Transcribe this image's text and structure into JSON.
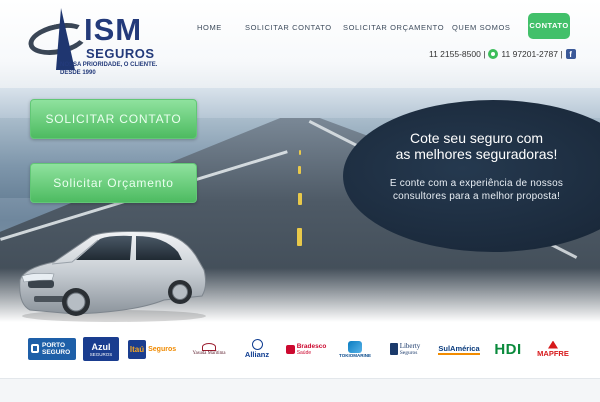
{
  "logo": {
    "name": "ISM",
    "sub": "SEGUROS",
    "tagline": "NOSSA PRIORIDADE, O CLIENTE.",
    "since": "DESDE 1990"
  },
  "nav": {
    "items": [
      "HOME",
      "SOLICITAR CONTATO",
      "SOLICITAR ORÇAMENTO",
      "QUEM SOMOS"
    ],
    "cta": "CONTATO"
  },
  "contact": {
    "phone1": "11 2155-8500 |",
    "phone2": "11 97201-2787 |",
    "facebook": "f"
  },
  "hero": {
    "btn_contato": "SOLICITAR CONTATO",
    "btn_orcamento": "Solicitar Orçamento",
    "promo_line1": "Cote seu seguro com",
    "promo_line2": "as melhores seguradoras!",
    "promo_sub1": "E conte com a experiência de nossos",
    "promo_sub2": "consultores para a melhor proposta!"
  },
  "partners": [
    {
      "id": "porto",
      "line1": "PORTO",
      "line2": "SEGURO"
    },
    {
      "id": "azul",
      "line1": "Azul",
      "line2": "SEGUROS"
    },
    {
      "id": "itau",
      "line1": "Itaú",
      "line2": "Seguros"
    },
    {
      "id": "yasuda",
      "line1": "Yasuda Marítima",
      "line2": ""
    },
    {
      "id": "allianz",
      "line1": "Allianz",
      "line2": ""
    },
    {
      "id": "bradesco",
      "line1": "Bradesco",
      "line2": "Saúde"
    },
    {
      "id": "tokio",
      "line1": "TOKIOMARINE",
      "line2": ""
    },
    {
      "id": "liberty",
      "line1": "Liberty",
      "line2": "Seguros"
    },
    {
      "id": "sulamerica",
      "line1": "SulAmérica",
      "line2": ""
    },
    {
      "id": "hdi",
      "line1": "HDI",
      "line2": ""
    },
    {
      "id": "mapfre",
      "line1": "MAPFRE",
      "line2": ""
    }
  ],
  "colors": {
    "brand_blue": "#233a7a",
    "cta_green": "#42c06a",
    "promo_dark": "#1b2a3c"
  }
}
